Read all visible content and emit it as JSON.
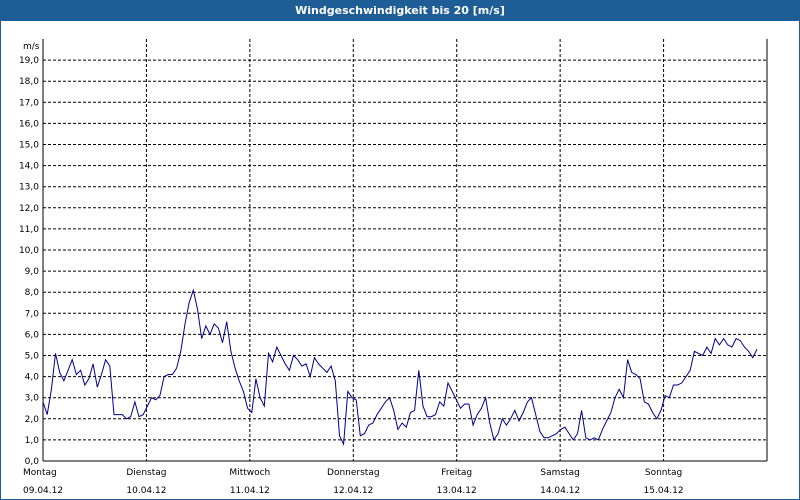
{
  "window": {
    "title": "Windgeschwindigkeit bis 20 [m/s]"
  },
  "colors": {
    "titlebar": "#1f5d96",
    "line": "#00008b",
    "grid": "#000000"
  },
  "chart_data": {
    "type": "line",
    "title": "Windgeschwindigkeit bis 20 [m/s]",
    "ylabel": "m/s",
    "ylim": [
      0,
      20
    ],
    "yticks": [
      "0,0",
      "1,0",
      "2,0",
      "3,0",
      "4,0",
      "5,0",
      "6,0",
      "7,0",
      "8,0",
      "9,0",
      "10,0",
      "11,0",
      "12,0",
      "13,0",
      "14,0",
      "15,0",
      "16,0",
      "17,0",
      "18,0",
      "19,0"
    ],
    "grid": true,
    "x_range_days": [
      "09.04.12",
      "16.04.12"
    ],
    "days": [
      {
        "name": "Montag",
        "date": "09.04.12"
      },
      {
        "name": "Dienstag",
        "date": "10.04.12"
      },
      {
        "name": "Mittwoch",
        "date": "11.04.12"
      },
      {
        "name": "Donnerstag",
        "date": "12.04.12"
      },
      {
        "name": "Freitag",
        "date": "13.04.12"
      },
      {
        "name": "Samstag",
        "date": "14.04.12"
      },
      {
        "name": "Sonntag",
        "date": "15.04.12"
      }
    ],
    "series": [
      {
        "values": [
          2.8,
          2.2,
          3.4,
          5.1,
          4.2,
          3.8,
          4.3,
          4.8,
          4.1,
          4.3,
          3.6,
          3.9,
          4.6,
          3.5,
          4.1,
          4.8,
          4.5,
          2.2,
          2.2,
          2.2,
          2.0,
          2.1,
          2.8,
          2.1,
          2.2,
          2.6,
          3.0,
          2.9,
          3.1,
          4.0,
          4.1,
          4.1,
          4.4,
          5.2,
          6.5,
          7.5,
          8.1,
          7.2,
          5.8,
          6.4,
          6.0,
          6.5,
          6.3,
          5.6,
          6.6,
          5.2,
          4.4,
          3.8,
          3.3,
          2.5,
          2.3,
          3.9,
          3.0,
          2.6,
          5.1,
          4.7,
          5.4,
          5.0,
          4.6,
          4.3,
          5.0,
          4.8,
          4.5,
          4.6,
          4.0,
          4.9,
          4.6,
          4.4,
          4.2,
          4.5,
          3.8,
          1.2,
          0.8,
          3.3,
          3.0,
          2.9,
          1.2,
          1.3,
          1.7,
          1.8,
          2.2,
          2.5,
          2.8,
          3.0,
          2.4,
          1.5,
          1.8,
          1.6,
          2.3,
          2.4,
          4.3,
          2.6,
          2.1,
          2.1,
          2.2,
          2.8,
          2.6,
          3.7,
          3.3,
          2.9,
          2.5,
          2.7,
          2.7,
          1.7,
          2.2,
          2.5,
          3.0,
          1.8,
          1.0,
          1.3,
          2.0,
          1.7,
          2.0,
          2.4,
          1.9,
          2.3,
          2.8,
          3.0,
          2.2,
          1.4,
          1.1,
          1.1,
          1.2,
          1.3,
          1.5,
          1.6,
          1.3,
          1.0,
          1.3,
          2.4,
          1.1,
          1.0,
          1.1,
          1.0,
          1.5,
          1.9,
          2.3,
          3.0,
          3.4,
          3.0,
          4.8,
          4.2,
          4.1,
          3.9,
          2.8,
          2.7,
          2.3,
          2.0,
          2.4,
          3.1,
          3.0,
          3.6,
          3.6,
          3.7,
          4.0,
          4.3,
          5.2,
          5.1,
          5.0,
          5.4,
          5.1,
          5.8,
          5.5,
          5.8,
          5.5,
          5.4,
          5.8,
          5.7,
          5.4,
          5.2,
          4.9,
          5.3
        ]
      }
    ]
  }
}
